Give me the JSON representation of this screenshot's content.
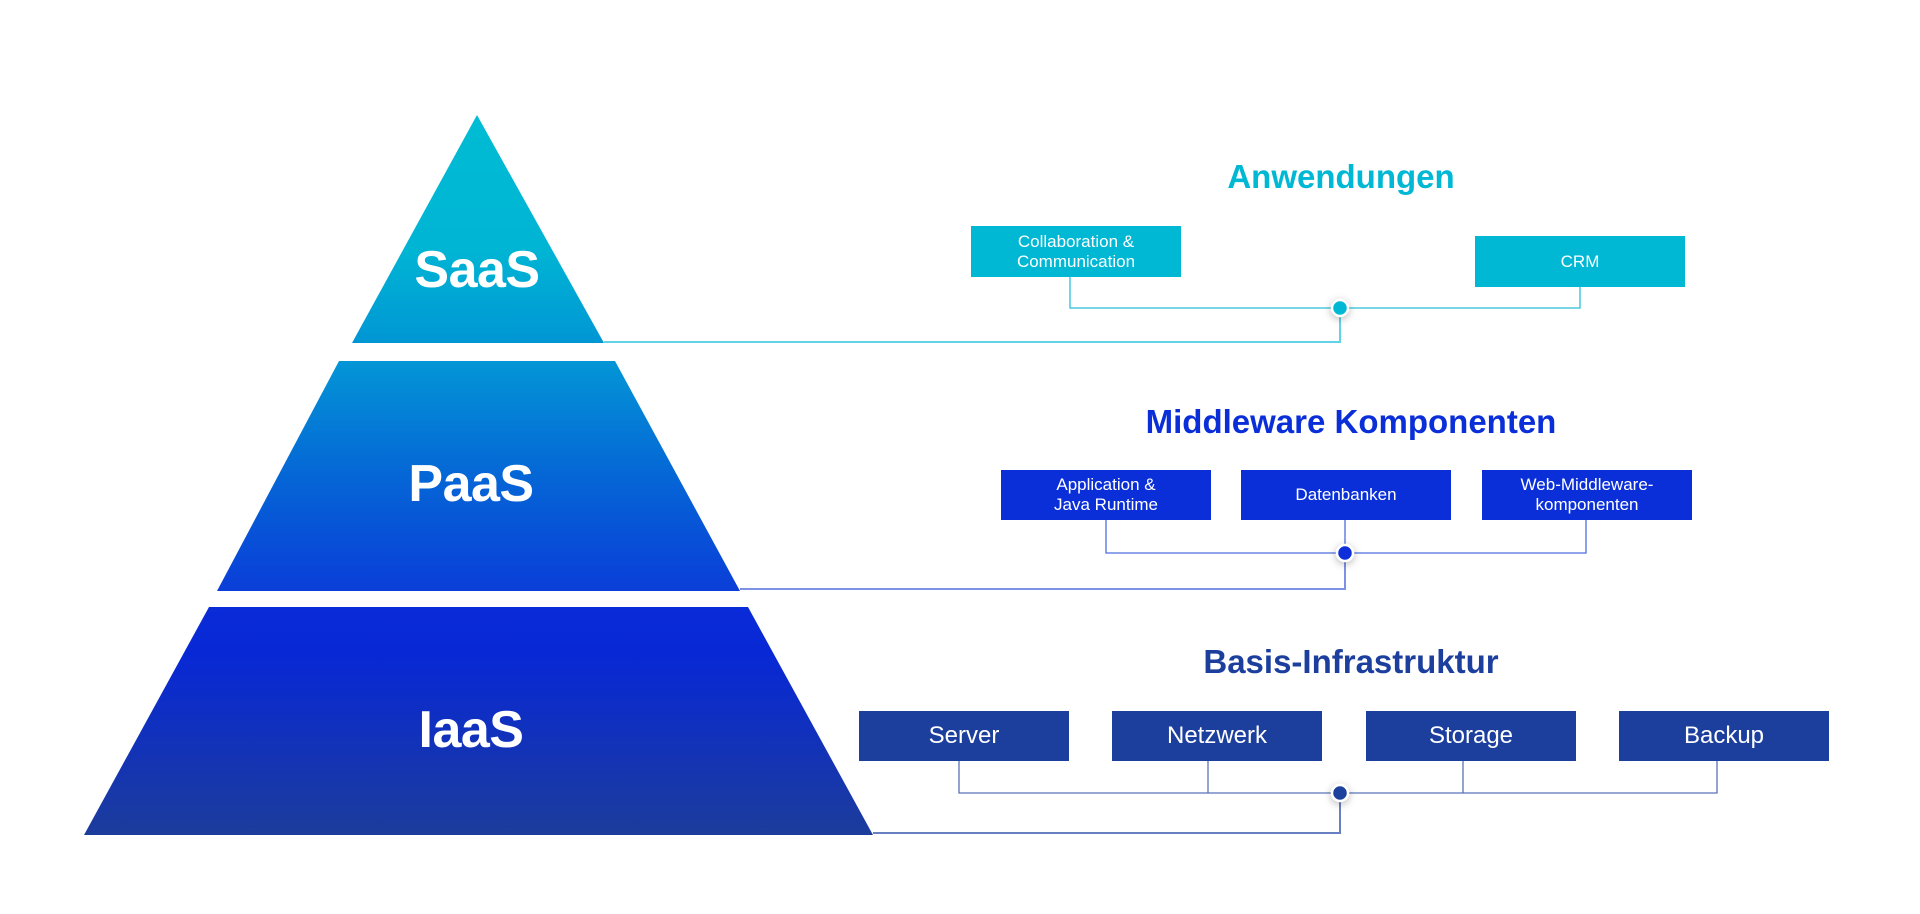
{
  "colors": {
    "saas": "#00b8d4",
    "paas": "#0a2fd8",
    "iaas": "#1c3f9e",
    "saas_line": "#5fd3e6",
    "paas_line": "#6b86e6",
    "iaas_line": "#5b73b8"
  },
  "pyramid": {
    "layers": [
      {
        "id": "saas",
        "label": "SaaS"
      },
      {
        "id": "paas",
        "label": "PaaS"
      },
      {
        "id": "iaas",
        "label": "IaaS"
      }
    ]
  },
  "groups": {
    "saas": {
      "title": "Anwendungen",
      "items": [
        "Collaboration &\nCommunication",
        "CRM"
      ]
    },
    "paas": {
      "title": "Middleware Komponenten",
      "items": [
        "Application &\nJava Runtime",
        "Datenbanken",
        "Web-Middleware-\nkomponenten"
      ]
    },
    "iaas": {
      "title": "Basis-Infrastruktur",
      "items": [
        "Server",
        "Netzwerk",
        "Storage",
        "Backup"
      ]
    }
  }
}
